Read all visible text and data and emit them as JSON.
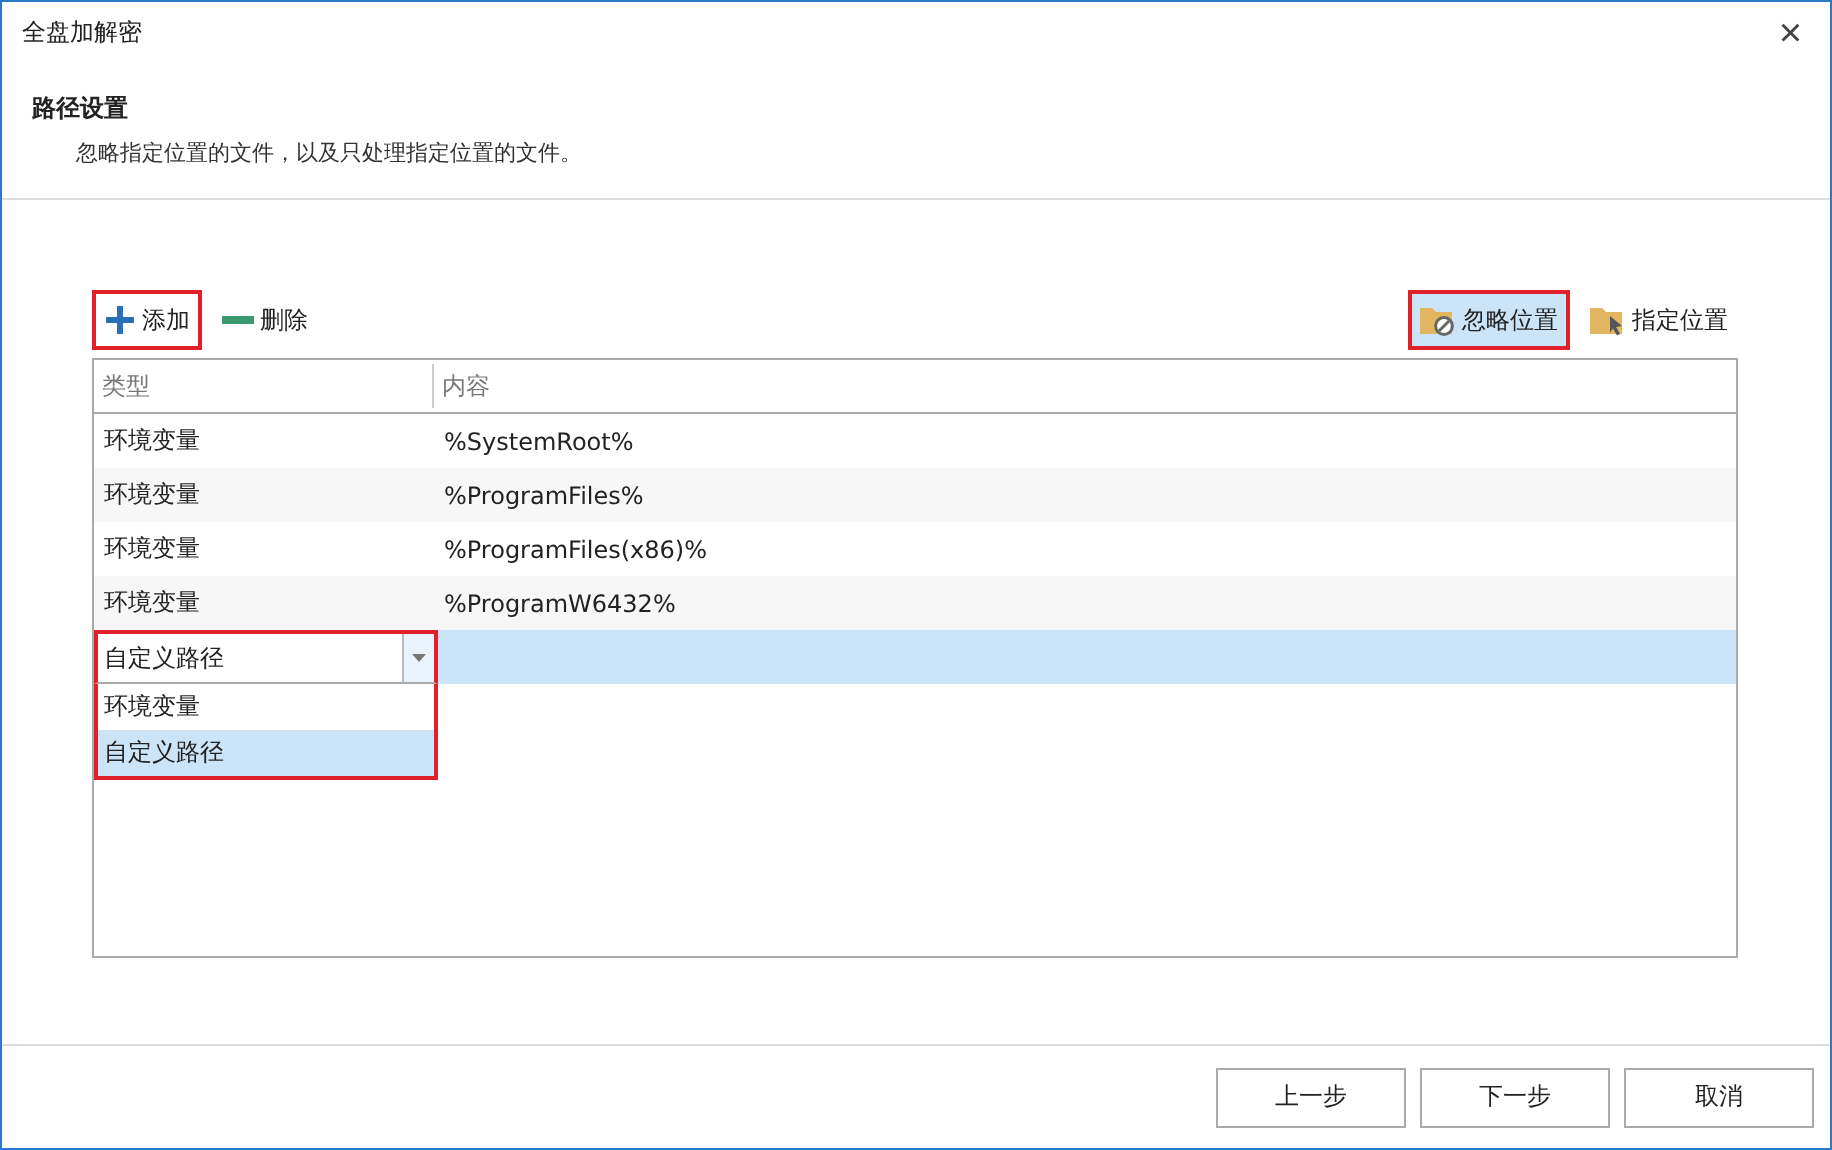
{
  "window": {
    "title": "全盘加解密",
    "close": "×"
  },
  "header": {
    "title": "路径设置",
    "description": "忽略指定位置的文件，以及只处理指定位置的文件。"
  },
  "toolbar": {
    "left": [
      {
        "kind": "add",
        "label": "添加",
        "highlighted": true
      },
      {
        "kind": "remove",
        "label": "删除",
        "highlighted": false
      }
    ],
    "right": [
      {
        "kind": "ignore",
        "label": "忽略位置",
        "selected": true,
        "highlighted": true
      },
      {
        "kind": "specify",
        "label": "指定位置",
        "selected": false,
        "highlighted": false
      }
    ]
  },
  "table": {
    "columns": [
      "类型",
      "内容"
    ],
    "rows": [
      {
        "type": "环境变量",
        "content": "%SystemRoot%",
        "selected": false
      },
      {
        "type": "环境变量",
        "content": "%ProgramFiles%",
        "selected": false
      },
      {
        "type": "环境变量",
        "content": "%ProgramFiles(x86)%",
        "selected": false
      },
      {
        "type": "环境变量",
        "content": "%ProgramW6432%",
        "selected": false
      },
      {
        "type": "自定义路径",
        "content": "",
        "selected": true,
        "editing": true
      }
    ],
    "dropdown": {
      "highlighted": true,
      "options": [
        {
          "label": "环境变量",
          "selected": false
        },
        {
          "label": "自定义路径",
          "selected": true
        }
      ]
    }
  },
  "buttons": [
    "上一步",
    "下一步",
    "取消"
  ]
}
